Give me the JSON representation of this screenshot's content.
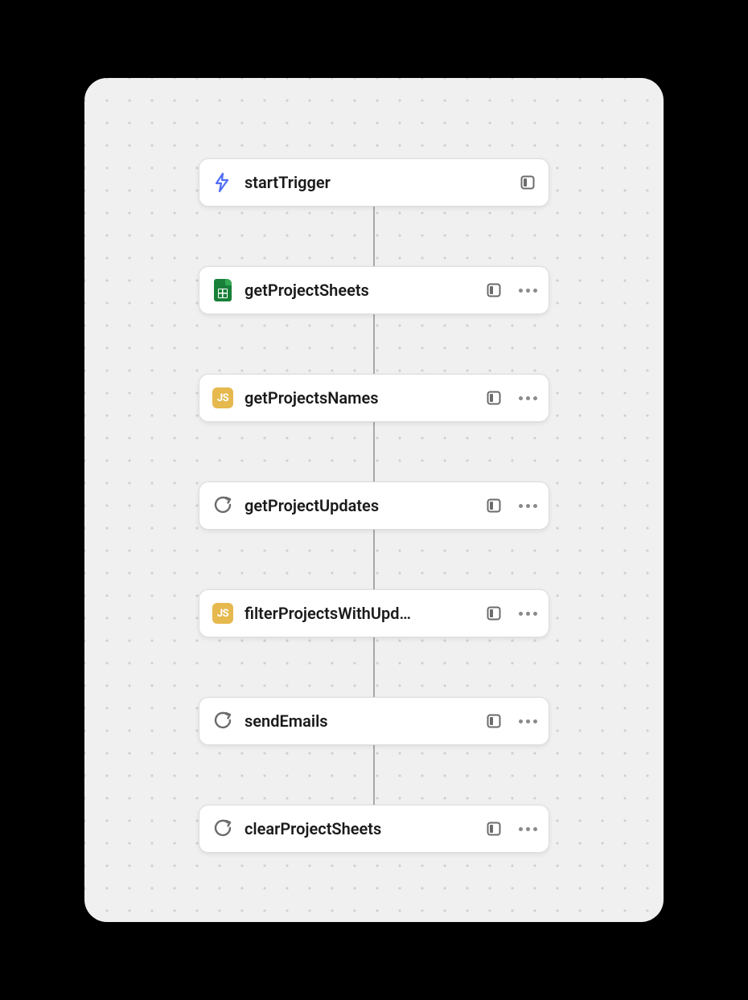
{
  "nodes": [
    {
      "id": "startTrigger",
      "label": "startTrigger",
      "icon": "lightning",
      "showMore": false
    },
    {
      "id": "getProjectSheets",
      "label": "getProjectSheets",
      "icon": "sheets",
      "showMore": true
    },
    {
      "id": "getProjectsNames",
      "label": "getProjectsNames",
      "icon": "js",
      "showMore": true
    },
    {
      "id": "getProjectUpdates",
      "label": "getProjectUpdates",
      "icon": "loop",
      "showMore": true
    },
    {
      "id": "filterProjectsWithUpdates",
      "label": "filterProjectsWithUpd…",
      "icon": "js",
      "showMore": true
    },
    {
      "id": "sendEmails",
      "label": "sendEmails",
      "icon": "loop",
      "showMore": true
    },
    {
      "id": "clearProjectSheets",
      "label": "clearProjectSheets",
      "icon": "loop",
      "showMore": true
    }
  ],
  "iconLabels": {
    "js": "JS"
  }
}
